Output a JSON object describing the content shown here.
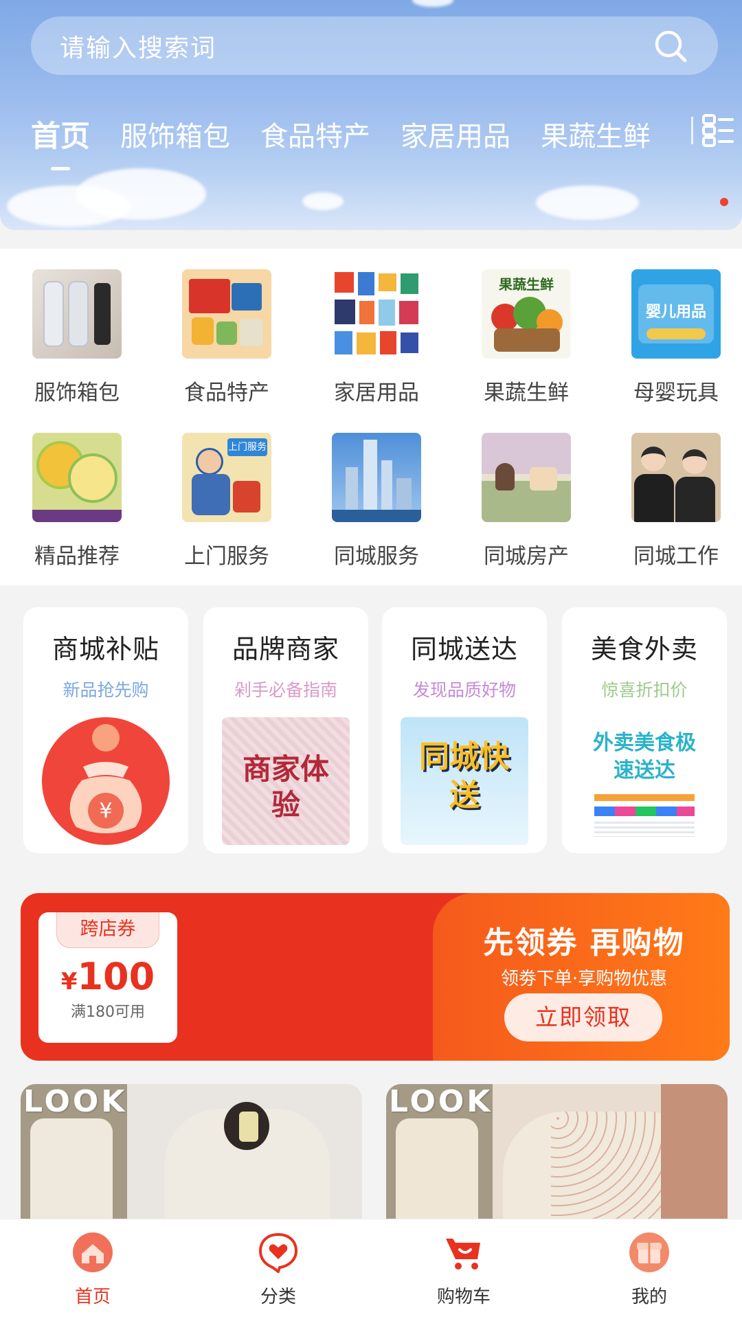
{
  "header": {
    "search": {
      "placeholder": "请输入搜索词"
    },
    "tabs": [
      {
        "label": "首页",
        "active": true
      },
      {
        "label": "服饰箱包"
      },
      {
        "label": "食品特产"
      },
      {
        "label": "家居用品"
      },
      {
        "label": "果蔬生鲜"
      }
    ]
  },
  "categories": [
    {
      "label": "服饰箱包",
      "icon": "clothing-thumbnail"
    },
    {
      "label": "食品特产",
      "icon": "food-thumbnail"
    },
    {
      "label": "家居用品",
      "icon": "household-thumbnail"
    },
    {
      "label": "果蔬生鲜",
      "icon": "produce-thumbnail",
      "img_text": "果蔬生鲜"
    },
    {
      "label": "母婴玩具",
      "icon": "baby-toys-thumbnail",
      "img_text": "婴儿用品"
    },
    {
      "label": "精品推荐",
      "icon": "featured-thumbnail"
    },
    {
      "label": "上门服务",
      "icon": "home-service-thumbnail",
      "img_text": "上门服务"
    },
    {
      "label": "同城服务",
      "icon": "city-service-thumbnail"
    },
    {
      "label": "同城房产",
      "icon": "real-estate-thumbnail"
    },
    {
      "label": "同城工作",
      "icon": "jobs-thumbnail"
    }
  ],
  "features": [
    {
      "title": "商城补贴",
      "subtitle": "新品抢先购",
      "subtitle_color": "#7ba6e6",
      "img_text": "¥"
    },
    {
      "title": "品牌商家",
      "subtitle": "剁手必备指南",
      "subtitle_color": "#d99bc6",
      "img_text": "商家体验"
    },
    {
      "title": "同城送达",
      "subtitle": "发现品质好物",
      "subtitle_color": "#c48ad6",
      "img_text": "同城快送"
    },
    {
      "title": "美食外卖",
      "subtitle": "惊喜折扣价",
      "subtitle_color": "#9cc98a",
      "img_text": "外卖美食极速送达"
    }
  ],
  "coupon": {
    "tag": "跨店券",
    "currency": "¥",
    "amount": "100",
    "condition": "满180可用",
    "headline": "先领券 再购物",
    "subline": "领劵下单·享购物优惠",
    "button": "立即领取",
    "colors": {
      "left": "#e8321f",
      "right": "#ff7a18"
    }
  },
  "products": [
    {
      "overlay": "LOOK"
    },
    {
      "overlay": "LOOK"
    }
  ],
  "bottom_nav": [
    {
      "label": "首页",
      "icon": "home-icon",
      "active": true
    },
    {
      "label": "分类",
      "icon": "category-heart-icon"
    },
    {
      "label": "购物车",
      "icon": "cart-icon"
    },
    {
      "label": "我的",
      "icon": "profile-icon"
    }
  ]
}
